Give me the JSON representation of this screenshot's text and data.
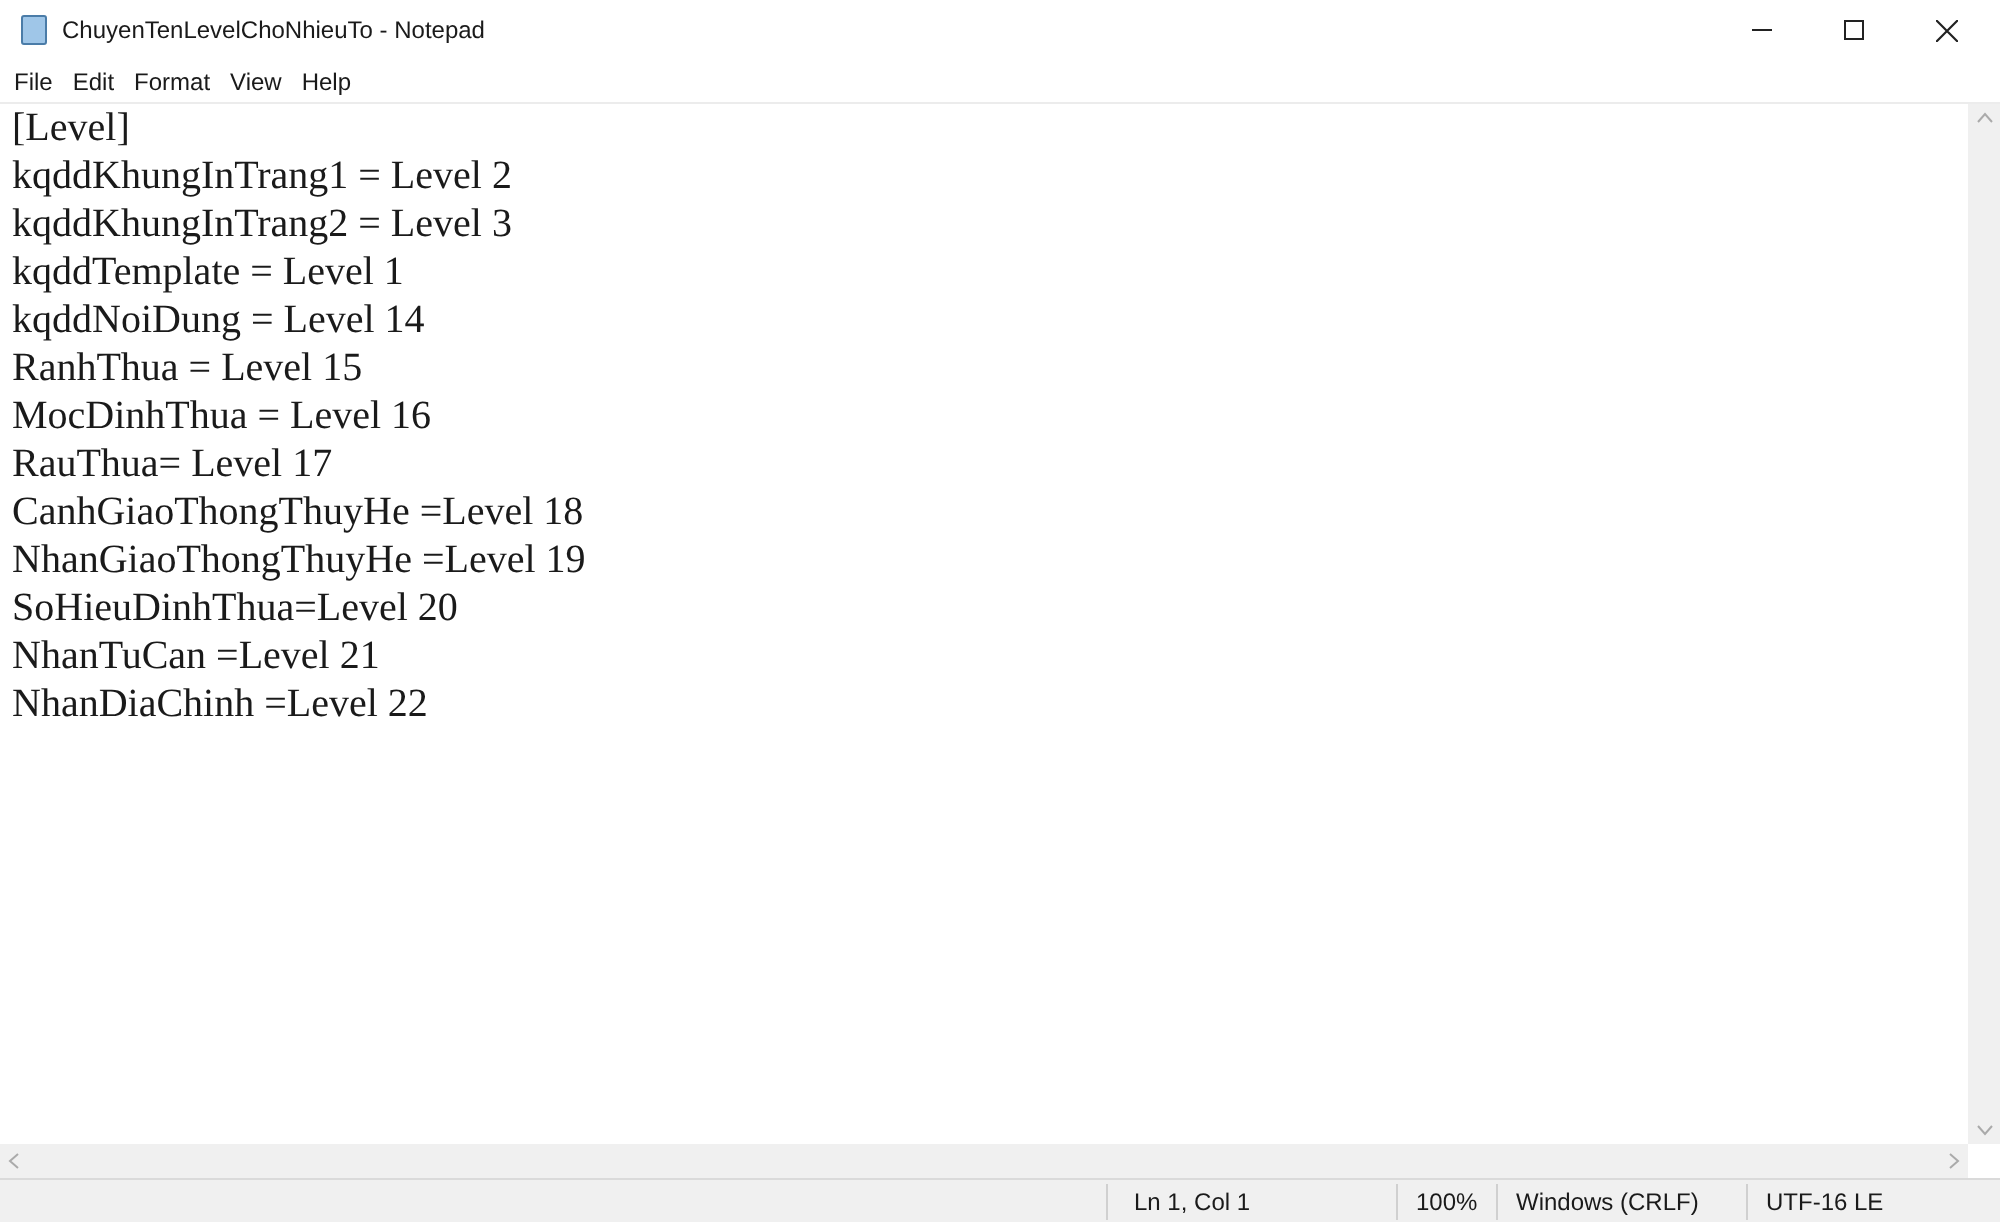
{
  "window": {
    "title": "ChuyenTenLevelChoNhieuTo - Notepad"
  },
  "menu": [
    "File",
    "Edit",
    "Format",
    "View",
    "Help"
  ],
  "editor": {
    "lines": [
      "[Level]",
      "kqddKhungInTrang1 = Level 2",
      "kqddKhungInTrang2 = Level 3",
      "kqddTemplate = Level 1",
      "kqddNoiDung = Level 14",
      "RanhThua = Level 15",
      "MocDinhThua = Level 16",
      "RauThua= Level 17",
      "CanhGiaoThongThuyHe =Level 18",
      "NhanGiaoThongThuyHe =Level 19",
      "SoHieuDinhThua=Level 20",
      "NhanTuCan =Level 21",
      "NhanDiaChinh =Level 22"
    ]
  },
  "status_bar": {
    "position": "Ln 1, Col 1",
    "zoom": "100%",
    "line_ending": "Windows (CRLF)",
    "encoding": "UTF-16 LE"
  }
}
